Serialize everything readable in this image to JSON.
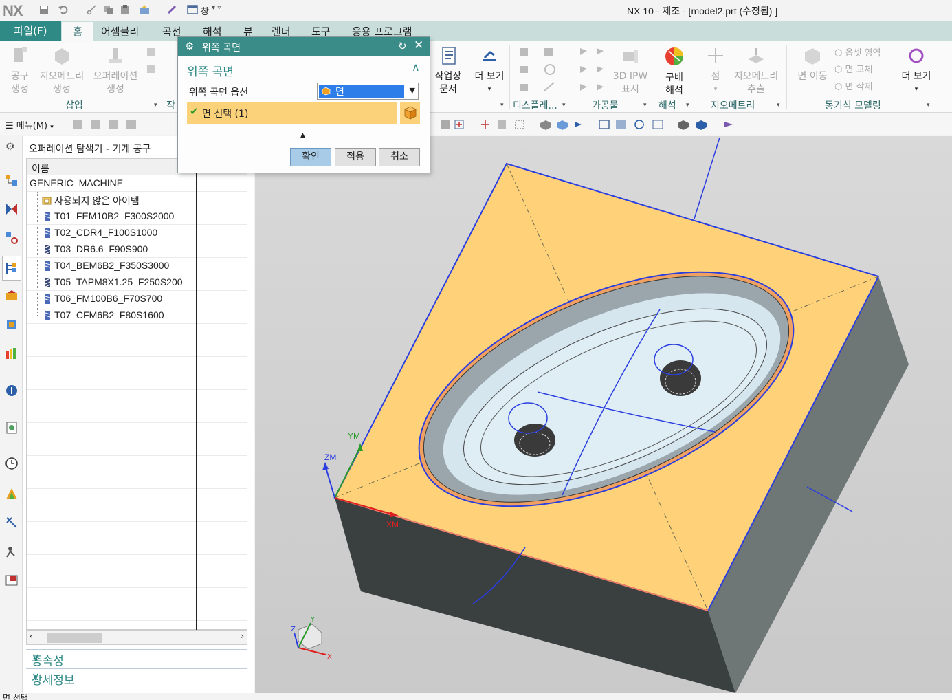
{
  "app": {
    "logo": "NX",
    "title": "NX 10 - 제조 - [model2.prt (수정됨) ]",
    "window_menu": "창"
  },
  "tabs": {
    "file": "파일(F)",
    "items": [
      "홈",
      "어셈블리",
      "곡선",
      "해석",
      "뷰",
      "렌더",
      "도구",
      "응용 프로그램"
    ]
  },
  "ribbon": {
    "buttons": [
      {
        "l1": "공구",
        "l2": "생성"
      },
      {
        "l1": "지오메트리",
        "l2": "생성"
      },
      {
        "l1": "오퍼레이션",
        "l2": "생성"
      },
      {
        "l1": "작업장",
        "l2": "문서"
      },
      {
        "l1": "더 보기",
        "l2": ""
      },
      {
        "l1": "3D IPW",
        "l2": "표시"
      },
      {
        "l1": "구배",
        "l2": "해석"
      },
      {
        "l1": "점",
        "l2": ""
      },
      {
        "l1": "지오메트리",
        "l2": "추출"
      },
      {
        "l1": "면 이동",
        "l2": ""
      },
      {
        "l1": "더 보기",
        "l2": ""
      }
    ],
    "sync_small": [
      "옵셋 영역",
      "면 교체",
      "면 삭제"
    ],
    "groups": [
      "삽입",
      "작",
      "디스플레...",
      "가공물",
      "해석",
      "지오메트리",
      "동기식 모델링"
    ]
  },
  "toolbar": {
    "menu": "메뉴(M)"
  },
  "navigator": {
    "title": "오퍼레이션 탐색기 - 기계 공구",
    "column": "이름",
    "root": "GENERIC_MACHINE",
    "unused": "사용되지 않은 아이템",
    "tools": [
      "T01_FEM10B2_F300S2000",
      "T02_CDR4_F100S1000",
      "T03_DR6.6_F90S900",
      "T04_BEM6B2_F350S3000",
      "T05_TAPM8X1.25_F250S200",
      "T06_FM100B6_F70S700",
      "T07_CFM6B2_F80S1600"
    ],
    "panes": [
      "종속성",
      "상세정보"
    ]
  },
  "dialog": {
    "title": "위쪽 곡면",
    "section": "위쪽 곡면",
    "option_label": "위쪽 곡면 옵션",
    "option_value": "면",
    "selection": "면 선택 (1)",
    "buttons": {
      "ok": "확인",
      "apply": "적용",
      "cancel": "취소"
    }
  },
  "viewport": {
    "axes": {
      "ym": "YM",
      "zm": "ZM",
      "xm": "XM"
    },
    "triad": {
      "x": "X",
      "y": "Y",
      "z": "Z"
    }
  },
  "status": {
    "text": "면 선택"
  },
  "colors": {
    "accent": "#2f8a86",
    "selection": "#fbd27a",
    "face_highlight": "#ffd27a",
    "edge": "#2a3ee0"
  }
}
